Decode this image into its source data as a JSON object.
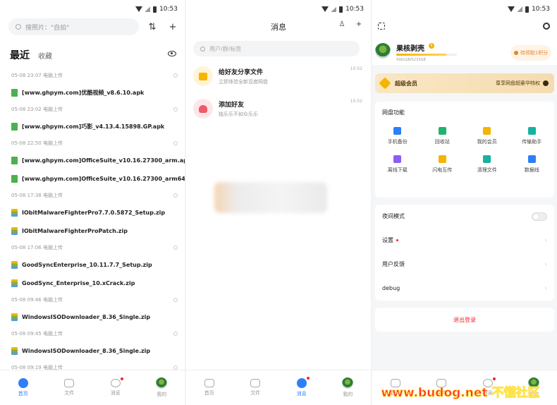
{
  "status_time": "10:53",
  "home": {
    "search_placeholder": "搜照片：\"自拍\"",
    "tab_recent": "最近",
    "tab_favorite": "收藏",
    "groups": [
      {
        "meta": "05-08 23:07  电脑上传",
        "files": [
          {
            "name": "[www.ghpym.com]优酷视频_v8.6.10.apk",
            "type": "apk"
          }
        ]
      },
      {
        "meta": "05-08 23:02  电脑上传",
        "files": [
          {
            "name": "[www.ghpym.com]巧影_v4.13.4.15898.GP.apk",
            "type": "apk"
          }
        ]
      },
      {
        "meta": "05-08 22:50  电脑上传",
        "files": [
          {
            "name": "[www.ghpym.com]OfficeSuite_v10.16.27300_arm.apk",
            "type": "apk"
          },
          {
            "name": "[www.ghpym.com]OfficeSuite_v10.16.27300_arm64.apk",
            "type": "apk"
          }
        ]
      },
      {
        "meta": "05-08 17:38  电脑上传",
        "files": [
          {
            "name": "IObitMalwareFighterPro7.7.0.5872_Setup.zip",
            "type": "zip"
          },
          {
            "name": "IObitMalwareFighterProPatch.zip",
            "type": "zip"
          }
        ]
      },
      {
        "meta": "05-08 17:06  电脑上传",
        "files": [
          {
            "name": "GoodSyncEnterprise_10.11.7.7_Setup.zip",
            "type": "zip"
          },
          {
            "name": "GoodSync_Enterprise_10.xCrack.zip",
            "type": "zip"
          }
        ]
      },
      {
        "meta": "05-08 09:46  电脑上传",
        "files": [
          {
            "name": "WindowsISODownloader_8.36_Single.zip",
            "type": "zip"
          }
        ]
      },
      {
        "meta": "05-08 09:45  电脑上传",
        "files": [
          {
            "name": "WindowsISODownloader_8.36_Single.zip",
            "type": "zip"
          }
        ]
      },
      {
        "meta": "05-08 09:19  电脑上传",
        "files": []
      }
    ]
  },
  "nav": {
    "home": "首页",
    "files": "文件",
    "messages": "消息",
    "mine": "我的"
  },
  "messages": {
    "title": "消息",
    "search_placeholder": "用户/群/标签",
    "items": [
      {
        "title": "给好友分享文件",
        "sub": "立即体验全新百度网盘",
        "time": "10:52",
        "color": "#f7b500",
        "bg": "#fff4d6"
      },
      {
        "title": "添加好友",
        "sub": "独乐乐不如众乐乐",
        "time": "10:52",
        "color": "#ef5b6a",
        "bg": "#fde6e8"
      }
    ]
  },
  "profile": {
    "username": "果核剥壳",
    "vip_level": "5",
    "quota_text": "4361GB/5233GB",
    "quota_fraction": 0.83,
    "points_label": "待领取1积分",
    "vip_title": "超级会员",
    "vip_promo": "尊享网盘超豪华特权",
    "features_title": "网盘功能",
    "features": [
      {
        "label": "手机备份",
        "color": "#2d7ff9"
      },
      {
        "label": "回收站",
        "color": "#20b36b"
      },
      {
        "label": "我的会员",
        "color": "#f4b400"
      },
      {
        "label": "传输助手",
        "color": "#16b2a0"
      },
      {
        "label": "离线下载",
        "color": "#8e5cf7"
      },
      {
        "label": "闪电互传",
        "color": "#f4b400"
      },
      {
        "label": "清理文件",
        "color": "#16b2a0"
      },
      {
        "label": "数据线",
        "color": "#2d7ff9"
      }
    ],
    "settings": [
      {
        "label": "夜间模式",
        "kind": "toggle"
      },
      {
        "label": "设置",
        "kind": "dot"
      },
      {
        "label": "用户反馈",
        "kind": "chevron"
      },
      {
        "label": "debug",
        "kind": "chevron"
      }
    ],
    "logout": "退出登录"
  },
  "watermark": "www.budog.net 不懂社区"
}
